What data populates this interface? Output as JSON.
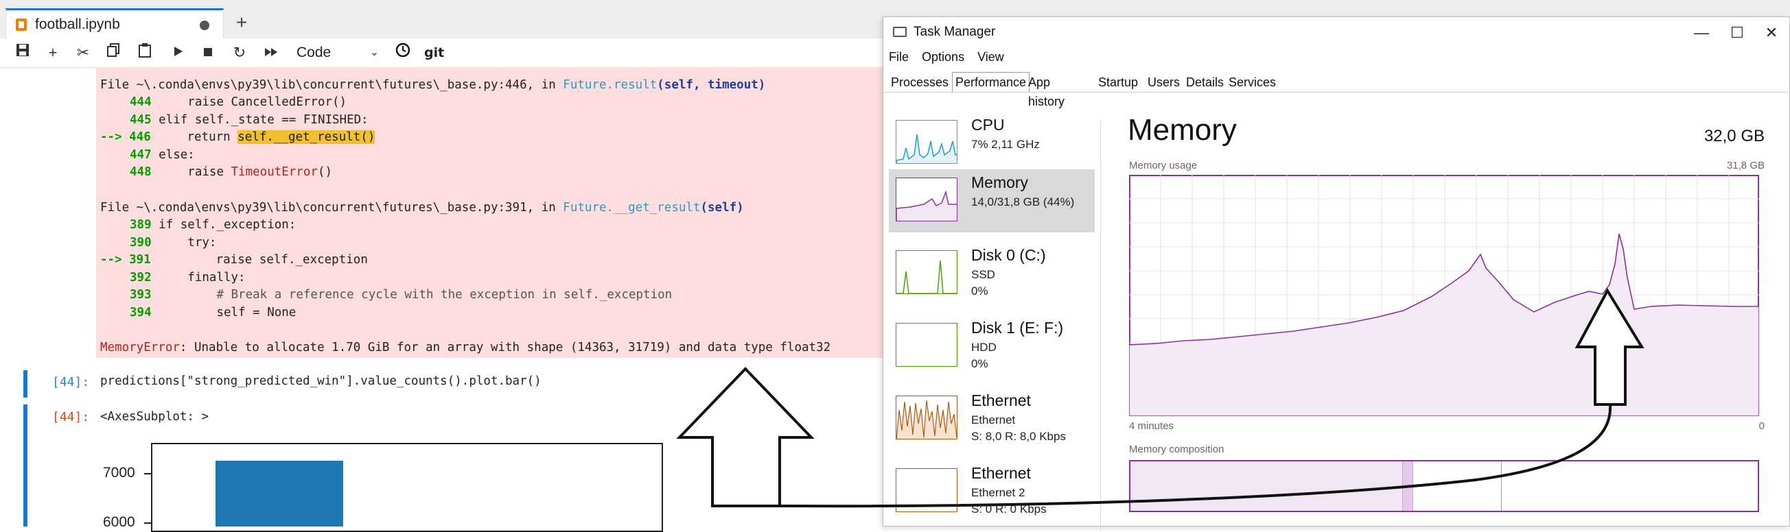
{
  "notebook": {
    "tab_title": "football.ipynb",
    "cell_type": "Code",
    "git_label": "git",
    "traceback": {
      "frame1_header": {
        "prefix": "File ~\\.conda\\envs\\py39\\lib\\concurrent\\futures\\_base.py:446, in ",
        "func": "Future.result",
        "args": "(self, timeout)"
      },
      "frame1_lines": [
        {
          "num": "444",
          "code": "    raise CancelledError()"
        },
        {
          "num": "445",
          "code": "elif self._state == FINISHED:"
        },
        {
          "arrow": "--> 446",
          "pre": "    return ",
          "highlight": "self.__get_result()"
        },
        {
          "num": "447",
          "code": "else:"
        },
        {
          "num": "448",
          "pre": "    raise ",
          "err": "TimeoutError",
          "post": "()"
        }
      ],
      "frame2_header": {
        "prefix": "File ~\\.conda\\envs\\py39\\lib\\concurrent\\futures\\_base.py:391, in ",
        "func": "Future.__get_result",
        "args": "(self)"
      },
      "frame2_lines": [
        {
          "num": "389",
          "code": "if self._exception:"
        },
        {
          "num": "390",
          "code": "    try:"
        },
        {
          "arrow": "--> 391",
          "code": "        raise self._exception"
        },
        {
          "num": "392",
          "code": "    finally:"
        },
        {
          "num": "393",
          "code": "        # Break a reference cycle with the exception in self._exception"
        },
        {
          "num": "394",
          "code": "        self = None"
        }
      ],
      "error_name": "MemoryError",
      "error_message": ": Unable to allocate 1.70 GiB for an array with shape (14363, 31719) and data type float32"
    },
    "cell44": {
      "in_prompt": "[44]:",
      "code": "predictions[\"strong_predicted_win\"].value_counts().plot.bar()",
      "out_prompt": "[44]:",
      "output_text": "<AxesSubplot: >"
    }
  },
  "chart_data": {
    "type": "bar",
    "title": "",
    "xlabel": "",
    "ylabel": "",
    "yticks": [
      "7000",
      "6000"
    ],
    "ylim": [
      5600,
      7800
    ],
    "categories": [
      ""
    ],
    "values": [
      7250
    ],
    "color": "#1f77b4"
  },
  "task_manager": {
    "title": "Task Manager",
    "menu": [
      "File",
      "Options",
      "View"
    ],
    "tabs": [
      "Processes",
      "Performance",
      "App history",
      "Startup",
      "Users",
      "Details",
      "Services"
    ],
    "active_tab": "Performance",
    "resources": [
      {
        "name": "CPU",
        "sub1": "7%  2,11 GHz",
        "sub2": "",
        "color": "#1ba1c8"
      },
      {
        "name": "Memory",
        "sub1": "14,0/31,8 GB (44%)",
        "sub2": "",
        "color": "#8b2f9e"
      },
      {
        "name": "Disk 0 (C:)",
        "sub1": "SSD",
        "sub2": "0%",
        "color": "#4da30d"
      },
      {
        "name": "Disk 1 (E: F:)",
        "sub1": "HDD",
        "sub2": "0%",
        "color": "#4da30d"
      },
      {
        "name": "Ethernet",
        "sub1": "Ethernet",
        "sub2": "S: 8,0  R: 8,0 Kbps",
        "color": "#a75c10"
      },
      {
        "name": "Ethernet",
        "sub1": "Ethernet 2",
        "sub2": "S: 0  R: 0 Kbps",
        "color": "#a75c10"
      }
    ],
    "memory_panel": {
      "heading": "Memory",
      "total": "32,0 GB",
      "usage_label": "Memory usage",
      "usage_max": "31,8 GB",
      "time_left": "4 minutes",
      "time_right": "0",
      "composition_label": "Memory composition",
      "accent": "#8b2f9e"
    }
  }
}
